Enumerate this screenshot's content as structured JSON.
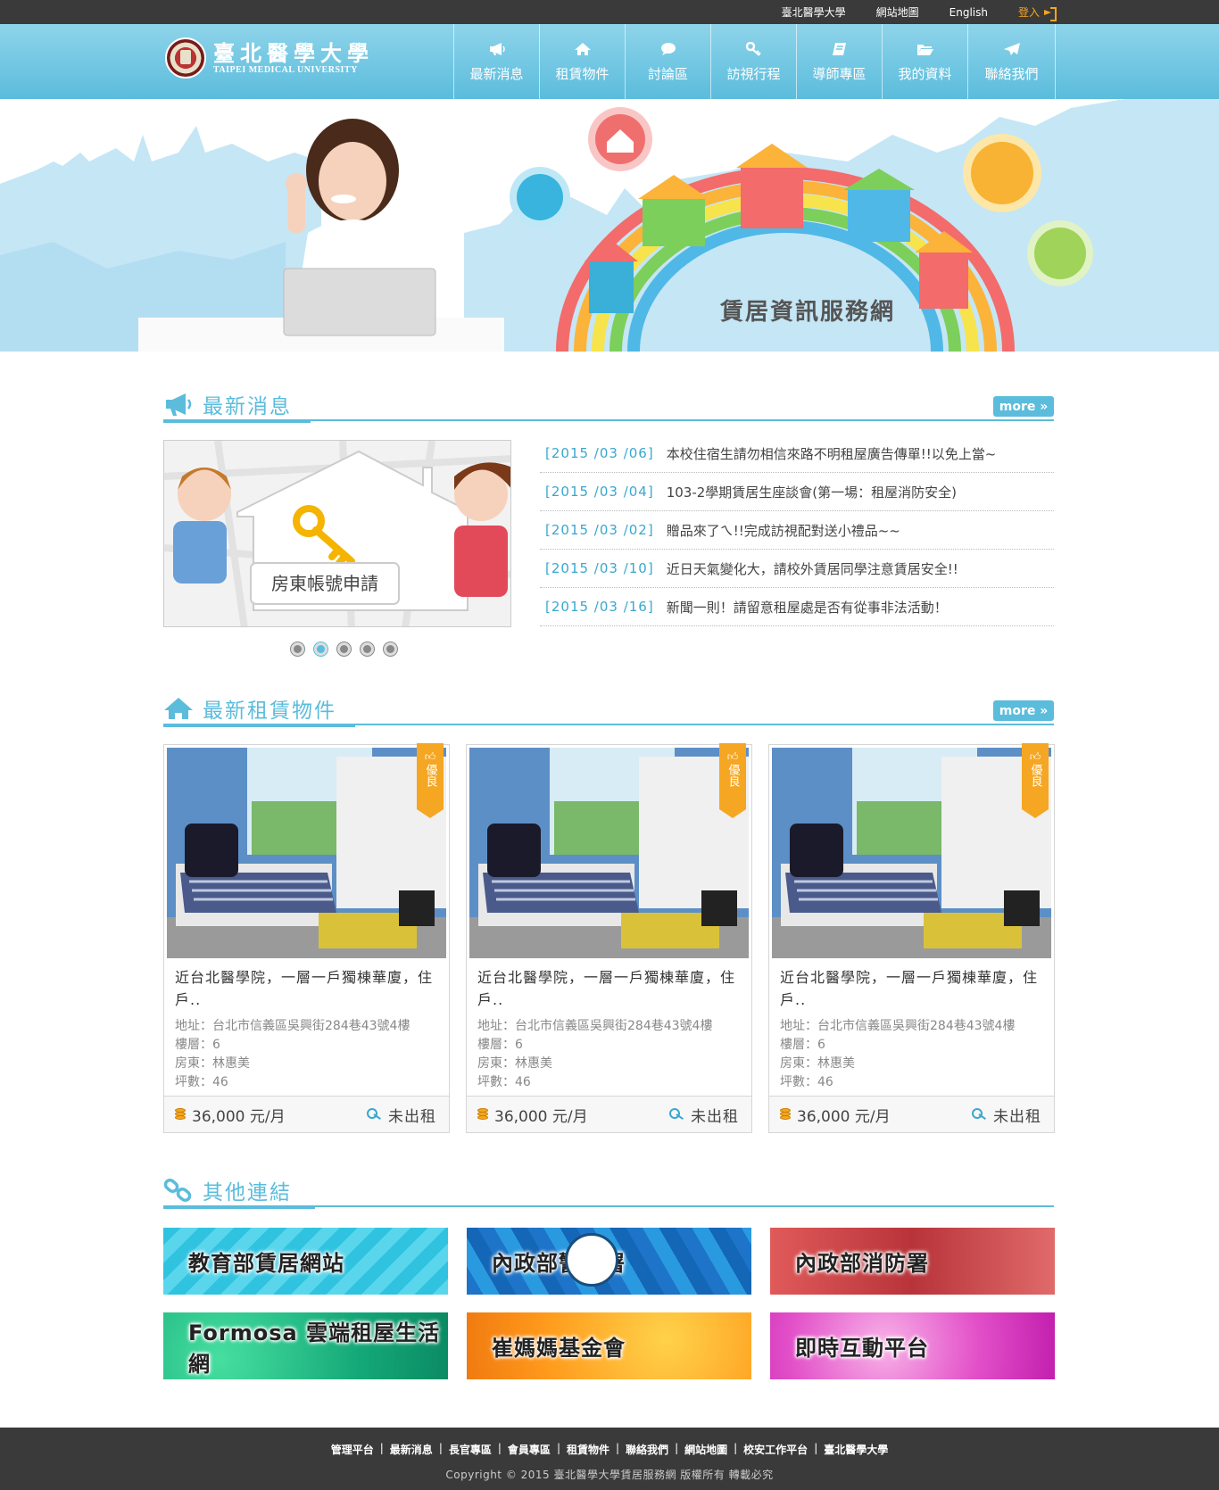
{
  "topbar": {
    "links": [
      "臺北醫學大學",
      "網站地圖",
      "English"
    ],
    "login": "登入"
  },
  "header": {
    "logo_cn": "臺北醫學大學",
    "logo_en": "TAIPEI MEDICAL UNIVERSITY",
    "nav": [
      {
        "label": "最新消息",
        "icon": "megaphone-icon"
      },
      {
        "label": "租賃物件",
        "icon": "home-icon"
      },
      {
        "label": "討論區",
        "icon": "chat-icon"
      },
      {
        "label": "訪視行程",
        "icon": "key-icon"
      },
      {
        "label": "導師專區",
        "icon": "book-icon"
      },
      {
        "label": "我的資料",
        "icon": "folder-icon"
      },
      {
        "label": "聯絡我們",
        "icon": "send-icon"
      }
    ]
  },
  "hero": {
    "title": "賃居資訊服務網"
  },
  "news": {
    "title": "最新消息",
    "more": "more",
    "banner_text": "房東帳號申請",
    "slide_count": 5,
    "active_slide": 2,
    "items": [
      {
        "date": "[2015 /03 /06]",
        "text": "本校住宿生請勿相信來路不明租屋廣告傳單!!以免上當~"
      },
      {
        "date": "[2015 /03 /04]",
        "text": "103-2學期賃居生座談會(第一場：租屋消防安全)"
      },
      {
        "date": "[2015 /03 /02]",
        "text": "贈品來了ㄟ!!完成訪視配對送小禮品~~"
      },
      {
        "date": "[2015 /03 /10]",
        "text": "近日天氣變化大，請校外賃居同學注意賃居安全!!"
      },
      {
        "date": "[2015 /03 /16]",
        "text": "新聞一則！請留意租屋處是否有從事非法活動！"
      }
    ]
  },
  "rentals": {
    "title": "最新租賃物件",
    "more": "more",
    "items": [
      {
        "badge": "優良",
        "title": "近台北醫學院，一層一戶獨棟華廈，住戶..",
        "address": "地址：台北市信義區吳興街284巷43號4樓",
        "floor": "樓層：6",
        "landlord": "房東：林惠美",
        "area": "坪數：46",
        "price": "36,000 元/月",
        "status": "未出租"
      },
      {
        "badge": "優良",
        "title": "近台北醫學院，一層一戶獨棟華廈，住戶..",
        "address": "地址：台北市信義區吳興街284巷43號4樓",
        "floor": "樓層：6",
        "landlord": "房東：林惠美",
        "area": "坪數：46",
        "price": "36,000 元/月",
        "status": "未出租"
      },
      {
        "badge": "優良",
        "title": "近台北醫學院，一層一戶獨棟華廈，住戶..",
        "address": "地址：台北市信義區吳興街284巷43號4樓",
        "floor": "樓層：6",
        "landlord": "房東：林惠美",
        "area": "坪數：46",
        "price": "36,000 元/月",
        "status": "未出租"
      }
    ]
  },
  "links": {
    "title": "其他連結",
    "items": [
      "教育部賃居網站",
      "內政部警政署",
      "內政部消防署",
      "Formosa 雲端租屋生活網",
      "崔媽媽基金會",
      "即時互動平台"
    ]
  },
  "footer": {
    "links": [
      "管理平台",
      "最新消息",
      "長官專區",
      "會員專區",
      "租賃物件",
      "聯絡我們",
      "網站地圖",
      "校安工作平台",
      "臺北醫學大學"
    ],
    "copyright": "Copyright © 2015 臺北醫學大學賃居服務網 版權所有 轉載必究"
  },
  "colors": {
    "accent": "#5bbcdc",
    "date": "#3aa7cf",
    "badge": "#f5a623",
    "dark": "#3a3a3a"
  }
}
